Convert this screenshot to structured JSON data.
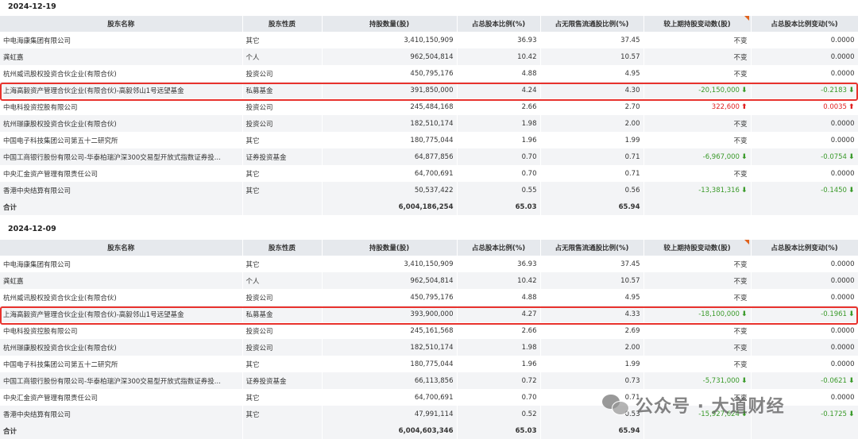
{
  "headers": [
    "股东名称",
    "股东性质",
    "持股数量(股)",
    "占总股本比例(%)",
    "占无限售流通股比例(%)",
    "较上期持股变动数(股)",
    "占总股本比例变动(%)"
  ],
  "sections": [
    {
      "date": "2024-12-19",
      "rows": [
        {
          "name": "中电海康集团有限公司",
          "type": "其它",
          "shares": "3,410,150,909",
          "pct_total": "36.93",
          "pct_float": "37.45",
          "chg": "不变",
          "chg_dir": "",
          "chg_pct": "0.0000",
          "chg_pct_dir": ""
        },
        {
          "name": "龚虹嘉",
          "type": "个人",
          "shares": "962,504,814",
          "pct_total": "10.42",
          "pct_float": "10.57",
          "chg": "不变",
          "chg_dir": "",
          "chg_pct": "0.0000",
          "chg_pct_dir": ""
        },
        {
          "name": "杭州威讯股权投资合伙企业(有限合伙)",
          "type": "投资公司",
          "shares": "450,795,176",
          "pct_total": "4.88",
          "pct_float": "4.95",
          "chg": "不变",
          "chg_dir": "",
          "chg_pct": "0.0000",
          "chg_pct_dir": ""
        },
        {
          "name": "上海高毅资产管理合伙企业(有限合伙)-高毅邻山1号远望基金",
          "type": "私募基金",
          "shares": "391,850,000",
          "pct_total": "4.24",
          "pct_float": "4.30",
          "chg": "-20,150,000",
          "chg_dir": "down",
          "chg_pct": "-0.2183",
          "chg_pct_dir": "down",
          "highlight": true
        },
        {
          "name": "中电科投资控股有限公司",
          "type": "投资公司",
          "shares": "245,484,168",
          "pct_total": "2.66",
          "pct_float": "2.70",
          "chg": "322,600",
          "chg_dir": "up",
          "chg_pct": "0.0035",
          "chg_pct_dir": "up"
        },
        {
          "name": "杭州璟康股权投资合伙企业(有限合伙)",
          "type": "投资公司",
          "shares": "182,510,174",
          "pct_total": "1.98",
          "pct_float": "2.00",
          "chg": "不变",
          "chg_dir": "",
          "chg_pct": "0.0000",
          "chg_pct_dir": ""
        },
        {
          "name": "中国电子科技集团公司第五十二研究所",
          "type": "其它",
          "shares": "180,775,044",
          "pct_total": "1.96",
          "pct_float": "1.99",
          "chg": "不变",
          "chg_dir": "",
          "chg_pct": "0.0000",
          "chg_pct_dir": ""
        },
        {
          "name": "中国工商银行股份有限公司-华泰柏瑞沪深300交易型开放式指数证券投...",
          "type": "证券投资基金",
          "shares": "64,877,856",
          "pct_total": "0.70",
          "pct_float": "0.71",
          "chg": "-6,967,000",
          "chg_dir": "down",
          "chg_pct": "-0.0754",
          "chg_pct_dir": "down"
        },
        {
          "name": "中央汇金资产管理有限责任公司",
          "type": "其它",
          "shares": "64,700,691",
          "pct_total": "0.70",
          "pct_float": "0.71",
          "chg": "不变",
          "chg_dir": "",
          "chg_pct": "0.0000",
          "chg_pct_dir": ""
        },
        {
          "name": "香港中央结算有限公司",
          "type": "其它",
          "shares": "50,537,422",
          "pct_total": "0.55",
          "pct_float": "0.56",
          "chg": "-13,381,316",
          "chg_dir": "down",
          "chg_pct": "-0.1450",
          "chg_pct_dir": "down"
        }
      ],
      "total": {
        "label": "合计",
        "shares": "6,004,186,254",
        "pct_total": "65.03",
        "pct_float": "65.94"
      }
    },
    {
      "date": "2024-12-09",
      "rows": [
        {
          "name": "中电海康集团有限公司",
          "type": "其它",
          "shares": "3,410,150,909",
          "pct_total": "36.93",
          "pct_float": "37.45",
          "chg": "不变",
          "chg_dir": "",
          "chg_pct": "0.0000",
          "chg_pct_dir": ""
        },
        {
          "name": "龚虹嘉",
          "type": "个人",
          "shares": "962,504,814",
          "pct_total": "10.42",
          "pct_float": "10.57",
          "chg": "不变",
          "chg_dir": "",
          "chg_pct": "0.0000",
          "chg_pct_dir": ""
        },
        {
          "name": "杭州威讯股权投资合伙企业(有限合伙)",
          "type": "投资公司",
          "shares": "450,795,176",
          "pct_total": "4.88",
          "pct_float": "4.95",
          "chg": "不变",
          "chg_dir": "",
          "chg_pct": "0.0000",
          "chg_pct_dir": ""
        },
        {
          "name": "上海高毅资产管理合伙企业(有限合伙)-高毅邻山1号远望基金",
          "type": "私募基金",
          "shares": "393,900,000",
          "pct_total": "4.27",
          "pct_float": "4.33",
          "chg": "-18,100,000",
          "chg_dir": "down",
          "chg_pct": "-0.1961",
          "chg_pct_dir": "down",
          "highlight": true
        },
        {
          "name": "中电科投资控股有限公司",
          "type": "投资公司",
          "shares": "245,161,568",
          "pct_total": "2.66",
          "pct_float": "2.69",
          "chg": "不变",
          "chg_dir": "",
          "chg_pct": "0.0000",
          "chg_pct_dir": ""
        },
        {
          "name": "杭州璟康股权投资合伙企业(有限合伙)",
          "type": "投资公司",
          "shares": "182,510,174",
          "pct_total": "1.98",
          "pct_float": "2.00",
          "chg": "不变",
          "chg_dir": "",
          "chg_pct": "0.0000",
          "chg_pct_dir": ""
        },
        {
          "name": "中国电子科技集团公司第五十二研究所",
          "type": "其它",
          "shares": "180,775,044",
          "pct_total": "1.96",
          "pct_float": "1.99",
          "chg": "不变",
          "chg_dir": "",
          "chg_pct": "0.0000",
          "chg_pct_dir": ""
        },
        {
          "name": "中国工商银行股份有限公司-华泰柏瑞沪深300交易型开放式指数证券投...",
          "type": "证券投资基金",
          "shares": "66,113,856",
          "pct_total": "0.72",
          "pct_float": "0.73",
          "chg": "-5,731,000",
          "chg_dir": "down",
          "chg_pct": "-0.0621",
          "chg_pct_dir": "down"
        },
        {
          "name": "中央汇金资产管理有限责任公司",
          "type": "其它",
          "shares": "64,700,691",
          "pct_total": "0.70",
          "pct_float": "0.71",
          "chg": "不变",
          "chg_dir": "",
          "chg_pct": "0.0000",
          "chg_pct_dir": ""
        },
        {
          "name": "香港中央结算有限公司",
          "type": "其它",
          "shares": "47,991,114",
          "pct_total": "0.52",
          "pct_float": "0.53",
          "chg": "-15,927,624",
          "chg_dir": "down",
          "chg_pct": "-0.1725",
          "chg_pct_dir": "down"
        }
      ],
      "total": {
        "label": "合计",
        "shares": "6,004,603,346",
        "pct_total": "65.03",
        "pct_float": "65.94"
      }
    }
  ],
  "watermark": {
    "text": "公众号 · 大道财经",
    "icon": "wechat-icon"
  },
  "colors": {
    "up": "#e02020",
    "down": "#3a9a2a",
    "highlight_border": "#e8322d",
    "header_bg": "#e6e9ed"
  }
}
